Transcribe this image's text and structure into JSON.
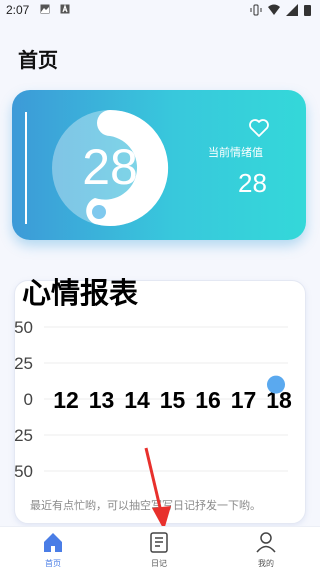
{
  "status": {
    "time": "2:07"
  },
  "header": {
    "title": "首页"
  },
  "mood_card": {
    "score": "28",
    "label": "当前情绪值",
    "value": "28"
  },
  "report": {
    "title": "心情报表",
    "hint": "最近有点忙哟，可以抽空写写日记抒发一下哟。"
  },
  "chart_data": {
    "type": "scatter",
    "y_ticks": [
      "50",
      "25",
      "0",
      "25",
      "50"
    ],
    "x_ticks": [
      "12",
      "13",
      "14",
      "15",
      "16",
      "17",
      "18"
    ],
    "ylim": [
      -50,
      50
    ],
    "points": [
      {
        "x": "18",
        "y": 10
      }
    ],
    "point_color": "#5aa9ef",
    "grid": true
  },
  "nav": {
    "items": [
      {
        "label": "首页",
        "icon": "home-icon",
        "active": true
      },
      {
        "label": "日记",
        "icon": "diary-icon",
        "active": false
      },
      {
        "label": "我的",
        "icon": "profile-icon",
        "active": false
      }
    ]
  },
  "colors": {
    "accent": "#4a7de6",
    "card_start": "#3d9ad8",
    "card_end": "#34d8d9"
  }
}
